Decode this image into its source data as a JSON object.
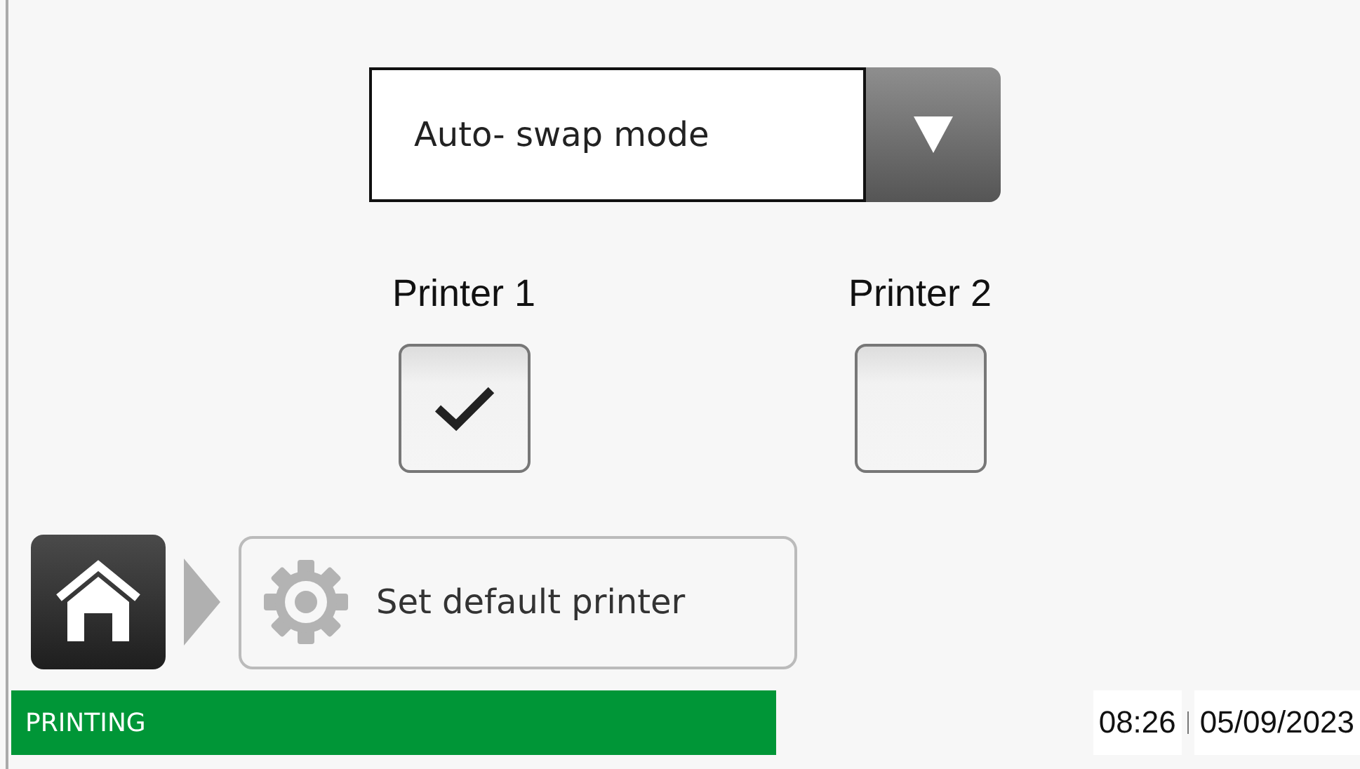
{
  "dropdown": {
    "value": "Auto- swap mode"
  },
  "printers": [
    {
      "label": "Printer 1",
      "checked": true
    },
    {
      "label": "Printer 2",
      "checked": false
    }
  ],
  "breadcrumb": {
    "label": "Set default printer"
  },
  "status_bar": {
    "status": "PRINTING",
    "time": "08:26",
    "date": "05/09/2023"
  }
}
